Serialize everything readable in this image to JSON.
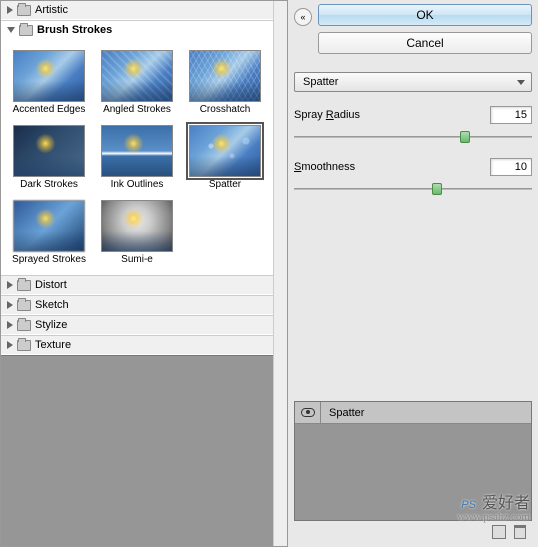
{
  "categories": {
    "artistic": "Artistic",
    "brush_strokes": "Brush Strokes",
    "distort": "Distort",
    "sketch": "Sketch",
    "stylize": "Stylize",
    "texture": "Texture"
  },
  "filters": [
    {
      "label": "Accented Edges"
    },
    {
      "label": "Angled Strokes"
    },
    {
      "label": "Crosshatch"
    },
    {
      "label": "Dark Strokes"
    },
    {
      "label": "Ink Outlines"
    },
    {
      "label": "Spatter"
    },
    {
      "label": "Sprayed Strokes"
    },
    {
      "label": "Sumi-e"
    }
  ],
  "selected_filter_index": 5,
  "buttons": {
    "ok": "OK",
    "cancel": "Cancel"
  },
  "dropdown": {
    "selected": "Spatter"
  },
  "params": {
    "spray_radius": {
      "label_pre": "Spray ",
      "label_u": "R",
      "label_post": "adius",
      "value": "15",
      "pos": 72
    },
    "smoothness": {
      "label_pre": "",
      "label_u": "S",
      "label_post": "moothness",
      "value": "10",
      "pos": 60
    }
  },
  "layer": {
    "name": "Spatter"
  },
  "watermark": {
    "brand": "PS",
    "cn": "爱好者",
    "url": "www.psahz.com"
  }
}
